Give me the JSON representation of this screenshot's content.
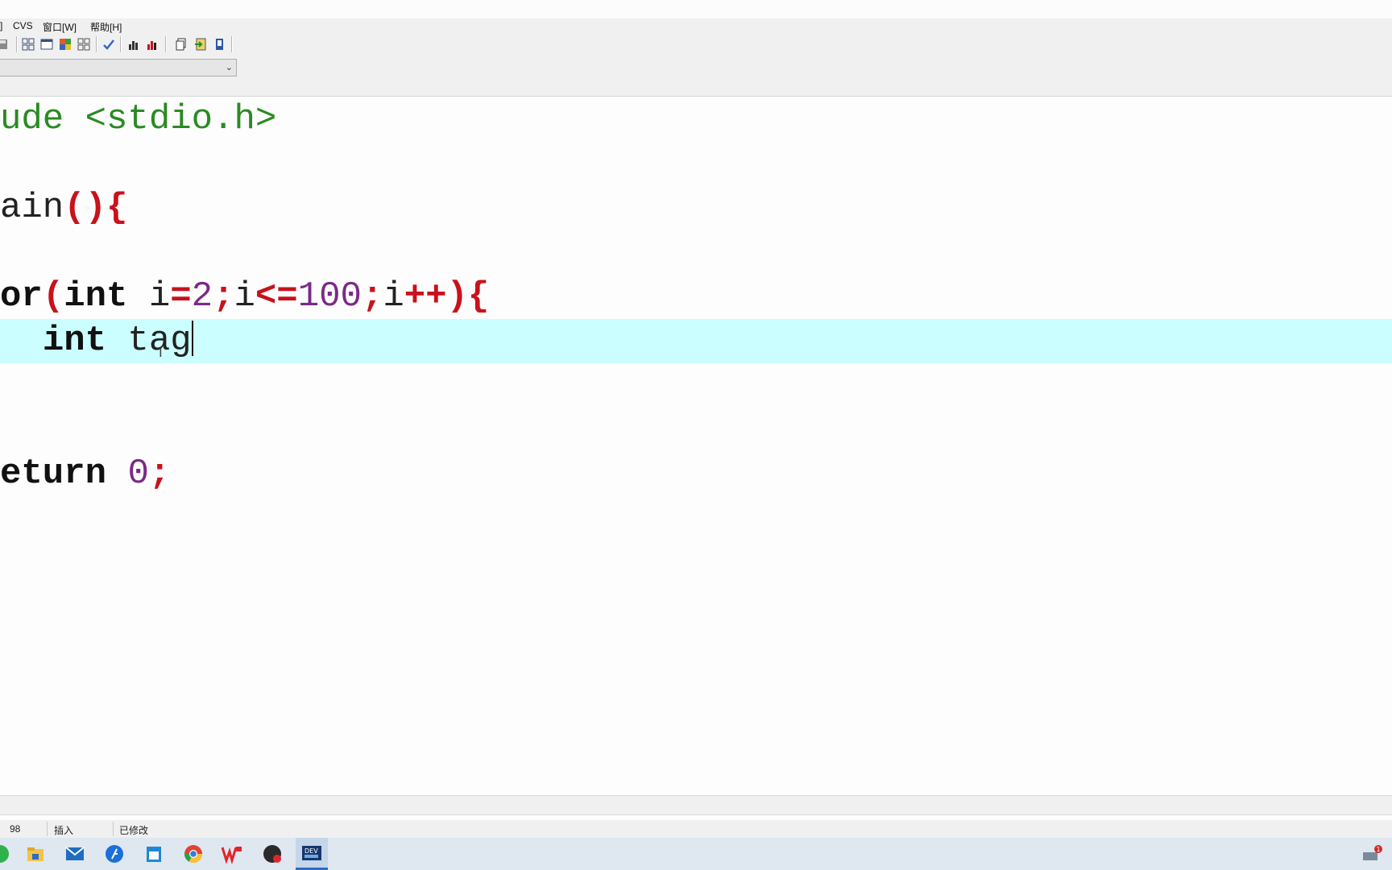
{
  "menu": {
    "items": [
      "]",
      "CVS",
      "窗口[W]",
      "帮助[H]"
    ]
  },
  "toolbar": {
    "icons": [
      "save-all-icon",
      "tile-icon",
      "window-icon",
      "cascade-icon",
      "arrange-icon",
      "check-icon",
      "chart-icon",
      "profile-icon",
      "copy-icon",
      "insert-icon",
      "bookmark-icon"
    ]
  },
  "combo": {
    "value": ""
  },
  "editor": {
    "lines": {
      "l1": {
        "pp": "ude <stdio.h>"
      },
      "l3": {
        "a": "ain",
        "b": "(){"
      },
      "l5": {
        "a": "or",
        "b": "(",
        "c": "int",
        "d": " i",
        "e": "=",
        "f": "2",
        "g": ";",
        "h": "i",
        "i": "<=",
        "j": "100",
        "k": ";",
        "l": "i",
        "m": "++){"
      },
      "l6": {
        "indent": "  ",
        "kw": "int",
        "ident": " tag"
      },
      "l9": {
        "kw": "eturn",
        "sp": " ",
        "num": "0",
        "sym": ";"
      }
    },
    "highlight_color": "#cbfefe"
  },
  "status": {
    "position": "98",
    "mode": "插入",
    "state": "已修改"
  },
  "taskbar": {
    "apps": [
      "wechat-icon",
      "file-explorer-icon",
      "mail-icon",
      "feishu-icon",
      "calendar-icon",
      "chrome-icon",
      "wps-icon",
      "obs-icon",
      "devcpp-icon"
    ],
    "tray_badge": "1"
  }
}
